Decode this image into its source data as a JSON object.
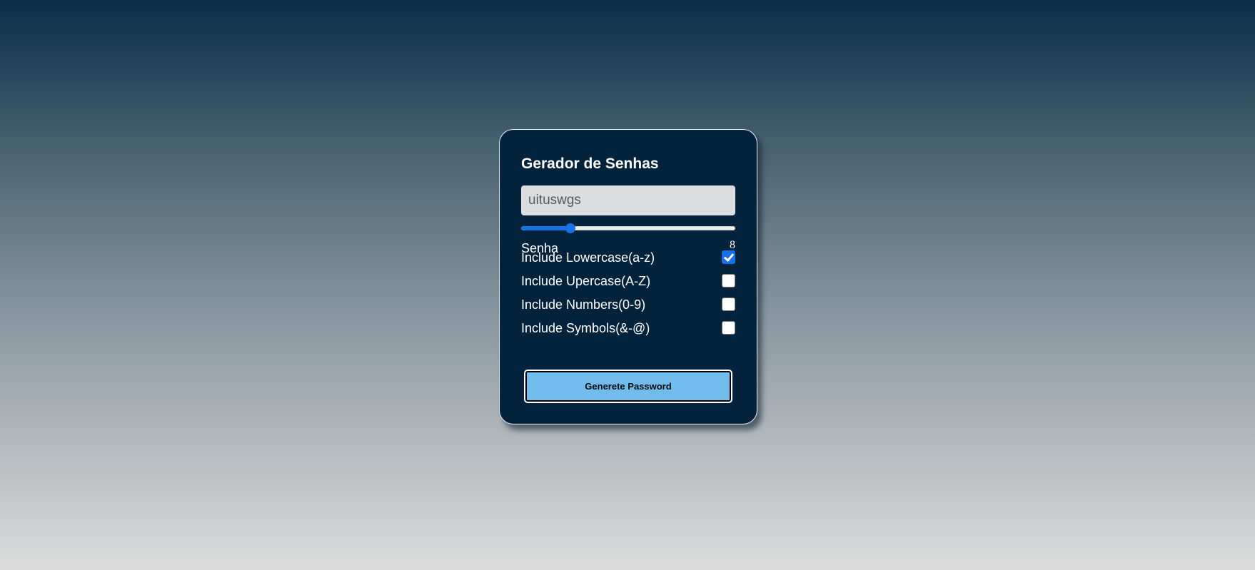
{
  "app": {
    "title": "Gerador de Senhas"
  },
  "password": {
    "value": "uituswgs"
  },
  "length": {
    "label": "Senha",
    "value": "8",
    "slider_fraction": 0.23
  },
  "options": [
    {
      "label": "Include Lowercase(a-z)",
      "checked": true
    },
    {
      "label": "Include Upercase(A-Z)",
      "checked": false
    },
    {
      "label": "Include Numbers(0-9)",
      "checked": false
    },
    {
      "label": "Include Symbols(&-@)",
      "checked": false
    }
  ],
  "actions": {
    "generate_label": "Generete Password"
  },
  "colors": {
    "card_background": "#03233d",
    "accent": "#1672e6",
    "button_background": "#72bbed"
  }
}
